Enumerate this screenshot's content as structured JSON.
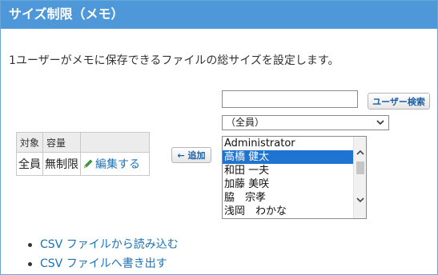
{
  "header": {
    "title": "サイズ制限（メモ）"
  },
  "description": "1ユーザーがメモに保存できるファイルの総サイズを設定します。",
  "table": {
    "columns": [
      "対象",
      "容量",
      ""
    ],
    "rows": [
      {
        "target": "全員",
        "capacity": "無制限",
        "action": "編集する"
      }
    ]
  },
  "add_button": {
    "label": "← 追加"
  },
  "search": {
    "value": "",
    "placeholder": "",
    "button_label": "ユーザー検索"
  },
  "group_select": {
    "selected": "（全員）"
  },
  "user_list": {
    "items": [
      "Administrator",
      "高橋 健太",
      "和田 一夫",
      "加藤 美咲",
      "脇　宗孝",
      "浅岡　わかな"
    ],
    "selected_index": 1
  },
  "links": [
    "CSV ファイルから読み込む",
    "CSV ファイルへ書き出す"
  ],
  "colors": {
    "header_bg": "#4e97d8",
    "link": "#1a73b8",
    "selection": "#1f74d1",
    "pencil": "#3aa13a"
  }
}
